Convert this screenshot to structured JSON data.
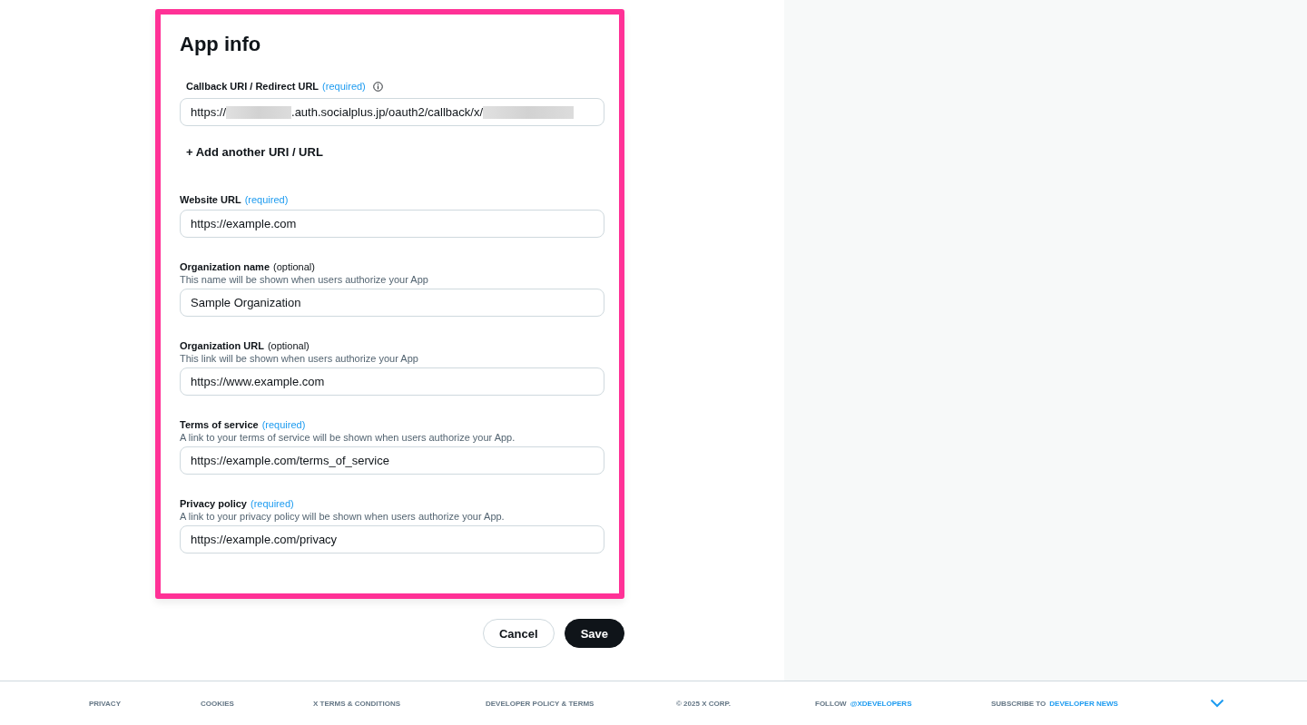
{
  "title": "App info",
  "callback": {
    "label": "Callback URI / Redirect URL",
    "tag": {
      "kind": "required",
      "text": "(required)"
    },
    "value": [
      {
        "kind": "text",
        "text": "https://"
      },
      {
        "kind": "redacted"
      },
      {
        "kind": "text",
        "text": ".auth.socialplus.jp/oauth2/callback/x/"
      },
      {
        "kind": "redacted"
      }
    ],
    "add_link": "+ Add another URI / URL"
  },
  "fields": [
    {
      "label": "Website URL",
      "tag": {
        "kind": "required",
        "text": "(required)"
      },
      "value": "https://example.com"
    },
    {
      "label": "Organization name",
      "tag": {
        "kind": "optional",
        "text": "(optional)"
      },
      "help": "This name will be shown when users authorize your App",
      "value": "Sample Organization"
    },
    {
      "label": "Organization URL",
      "tag": {
        "kind": "optional",
        "text": "(optional)"
      },
      "help": "This link will be shown when users authorize your App",
      "value": "https://www.example.com"
    },
    {
      "label": "Terms of service",
      "tag": {
        "kind": "required",
        "text": "(required)"
      },
      "help": "A link to your terms of service will be shown when users authorize your App.",
      "value": "https://example.com/terms_of_service"
    },
    {
      "label": "Privacy policy",
      "tag": {
        "kind": "required",
        "text": "(required)"
      },
      "help": "A link to your privacy policy will be shown when users authorize your App.",
      "value": "https://example.com/privacy"
    }
  ],
  "buttons": [
    {
      "kind": "secondary",
      "label": "Cancel"
    },
    {
      "kind": "primary",
      "label": "Save"
    }
  ],
  "footer": [
    {
      "kind": "link",
      "text": "PRIVACY"
    },
    {
      "kind": "link",
      "text": "COOKIES"
    },
    {
      "kind": "link",
      "text": "X TERMS & CONDITIONS"
    },
    {
      "kind": "link",
      "text": "DEVELOPER POLICY & TERMS"
    },
    {
      "kind": "text",
      "text": "© 2025 X CORP."
    },
    {
      "kind": "split",
      "prefix": "FOLLOW",
      "link": "@XDEVELOPERS"
    },
    {
      "kind": "split",
      "prefix": "SUBSCRIBE TO",
      "link": "DEVELOPER NEWS"
    }
  ]
}
